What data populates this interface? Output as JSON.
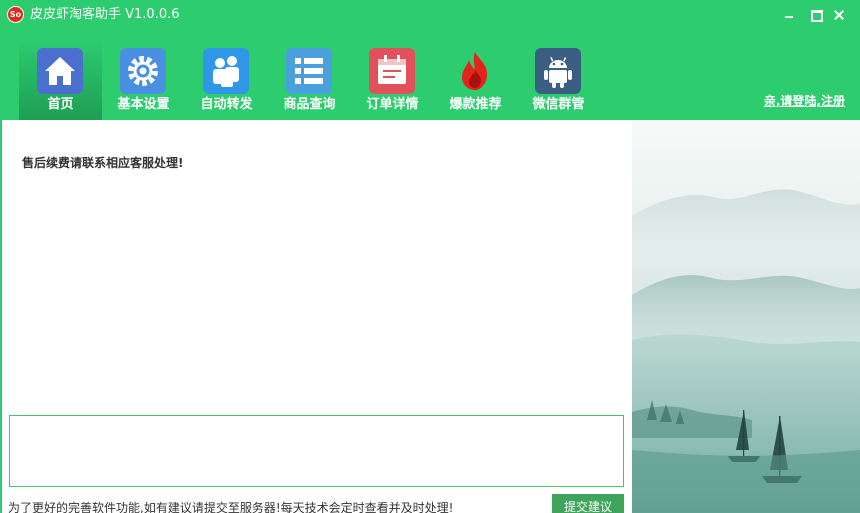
{
  "window": {
    "logo_text": "So",
    "title": "皮皮虾淘客助手 V1.0.0.6"
  },
  "toolbar": [
    {
      "key": "home",
      "label": "首页",
      "icon": "home-icon",
      "active": true
    },
    {
      "key": "basic-settings",
      "label": "基本设置",
      "icon": "gear-icon",
      "active": false
    },
    {
      "key": "auto-forward",
      "label": "自动转发",
      "icon": "users-icon",
      "active": false
    },
    {
      "key": "product-query",
      "label": "商品查询",
      "icon": "list-icon",
      "active": false
    },
    {
      "key": "order-details",
      "label": "订单详情",
      "icon": "calendar-icon",
      "active": false
    },
    {
      "key": "hot-recommend",
      "label": "爆款推荐",
      "icon": "fire-icon",
      "active": false
    },
    {
      "key": "wechat-groups",
      "label": "微信群管",
      "icon": "android-icon",
      "active": false
    }
  ],
  "header": {
    "login_link": "亲,请登陆,注册"
  },
  "main": {
    "notice": "售后续费请联系相应客服处理!",
    "suggestion_value": "",
    "footer_text": "为了更好的完善软件功能,如有建议请提交至服务器!每天技术会定时查看并及时处理!",
    "submit_label": "提交建议"
  },
  "colors": {
    "brand_green": "#2dcc6e",
    "active_tab": "#1f9e54",
    "submit_button": "#3fa45c",
    "logo_red": "#e02a1f"
  }
}
